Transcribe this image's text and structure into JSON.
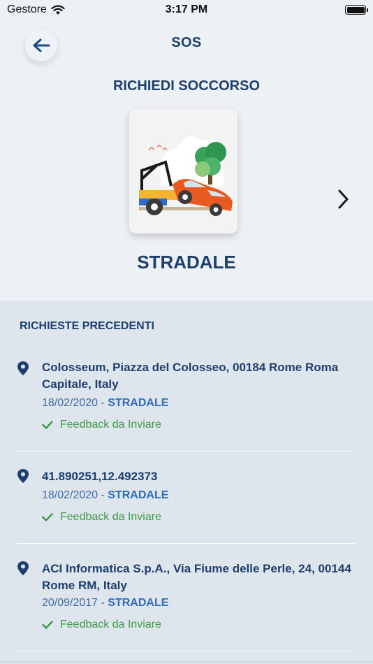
{
  "status": {
    "carrier": "Gestore",
    "time": "3:17 PM"
  },
  "header": {
    "title": "SOS"
  },
  "request": {
    "section_title": "RICHIEDI SOCCORSO",
    "category_label": "STRADALE"
  },
  "previous": {
    "title": "RICHIESTE PRECEDENTI",
    "items": [
      {
        "address": "Colosseum, Piazza del Colosseo, 00184 Rome Roma Capitale, Italy",
        "date": "18/02/2020",
        "separator": " - ",
        "type": "STRADALE",
        "feedback": "Feedback da Inviare"
      },
      {
        "address": "41.890251,12.492373",
        "date": "18/02/2020",
        "separator": " - ",
        "type": "STRADALE",
        "feedback": "Feedback da Inviare"
      },
      {
        "address": "ACI Informatica S.p.A., Via Fiume delle Perle, 24, 00144 Rome RM, Italy",
        "date": "20/09/2017",
        "separator": " - ",
        "type": "STRADALE",
        "feedback": "Feedback da Inviare"
      }
    ]
  },
  "colors": {
    "primary": "#1d3f6e",
    "accent": "#2c6cb8",
    "success": "#3e9b47",
    "top_bg": "#edf0f4",
    "list_bg": "#dfe5ed"
  },
  "icons": {
    "back": "arrow-left-icon",
    "next": "chevron-right-icon",
    "pin": "location-pin-icon",
    "check": "check-icon",
    "illustration": "tow-truck-icon"
  }
}
